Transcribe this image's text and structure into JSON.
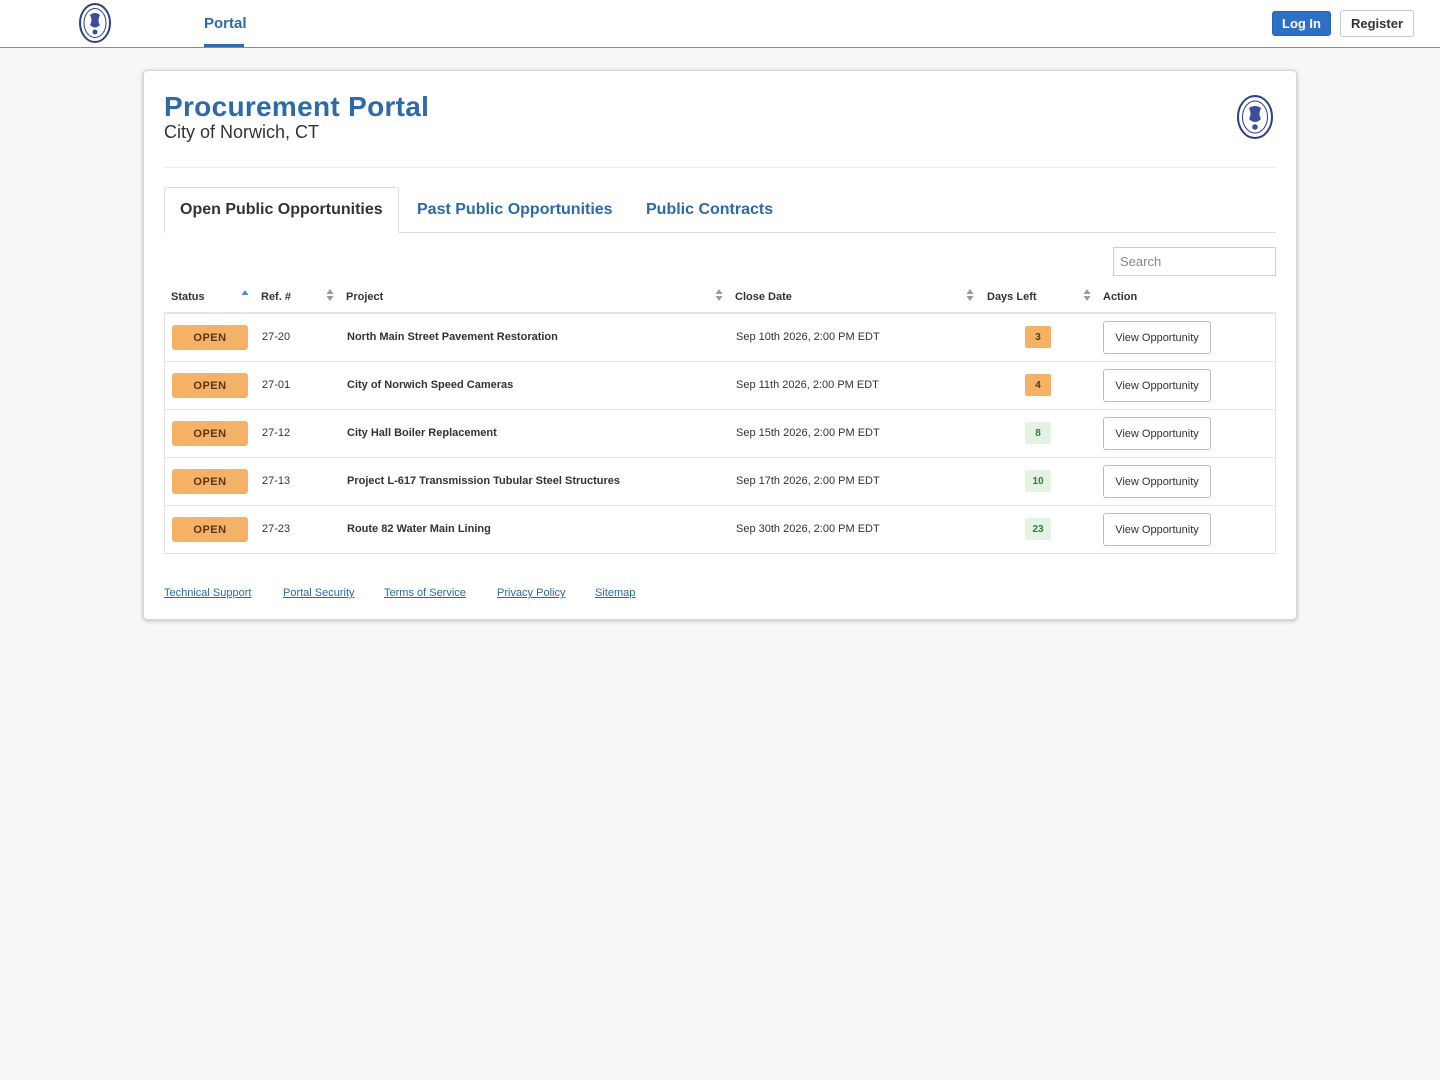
{
  "header": {
    "nav_portal": "Portal",
    "login_label": "Log In",
    "register_label": "Register",
    "logo_icon": "city-seal-icon"
  },
  "page": {
    "title": "Procurement Portal",
    "subtitle": "City of Norwich, CT"
  },
  "tabs": [
    {
      "label": "Open Public Opportunities",
      "active": true
    },
    {
      "label": "Past Public Opportunities",
      "active": false
    },
    {
      "label": "Public Contracts",
      "active": false
    }
  ],
  "search": {
    "placeholder": "Search",
    "value": ""
  },
  "table": {
    "columns": [
      "Status",
      "Ref. #",
      "Project",
      "Close Date",
      "Days Left",
      "Action"
    ],
    "rows": [
      {
        "status": "OPEN",
        "ref": "27-20",
        "project": "North Main Street Pavement Restoration",
        "close_date": "Sep 10th 2026, 2:00 PM EDT",
        "days_left": "3",
        "action": "View Opportunity"
      },
      {
        "status": "OPEN",
        "ref": "27-01",
        "project": "City of Norwich Speed Cameras",
        "close_date": "Sep 11th 2026, 2:00 PM EDT",
        "days_left": "4",
        "action": "View Opportunity"
      },
      {
        "status": "OPEN",
        "ref": "27-12",
        "project": "City Hall Boiler Replacement",
        "close_date": "Sep 15th 2026, 2:00 PM EDT",
        "days_left": "8",
        "action": "View Opportunity"
      },
      {
        "status": "OPEN",
        "ref": "27-13",
        "project": "Project L-617 Transmission Tubular Steel Structures",
        "close_date": "Sep 17th 2026, 2:00 PM EDT",
        "days_left": "10",
        "action": "View Opportunity"
      },
      {
        "status": "OPEN",
        "ref": "27-23",
        "project": "Route 82 Water Main Lining",
        "close_date": "Sep 30th 2026, 2:00 PM EDT",
        "days_left": "23",
        "action": "View Opportunity"
      }
    ]
  },
  "footer": {
    "links": [
      "Technical Support",
      "Portal Security",
      "Terms of Service",
      "Privacy Policy",
      "Sitemap"
    ]
  },
  "colors": {
    "brand_blue": "#2c6aa8",
    "login_blue": "#2f6fc4",
    "open_orange": "#f5b266",
    "days_green_bg": "#e3f2e3",
    "days_green_text": "#2e7d32"
  }
}
